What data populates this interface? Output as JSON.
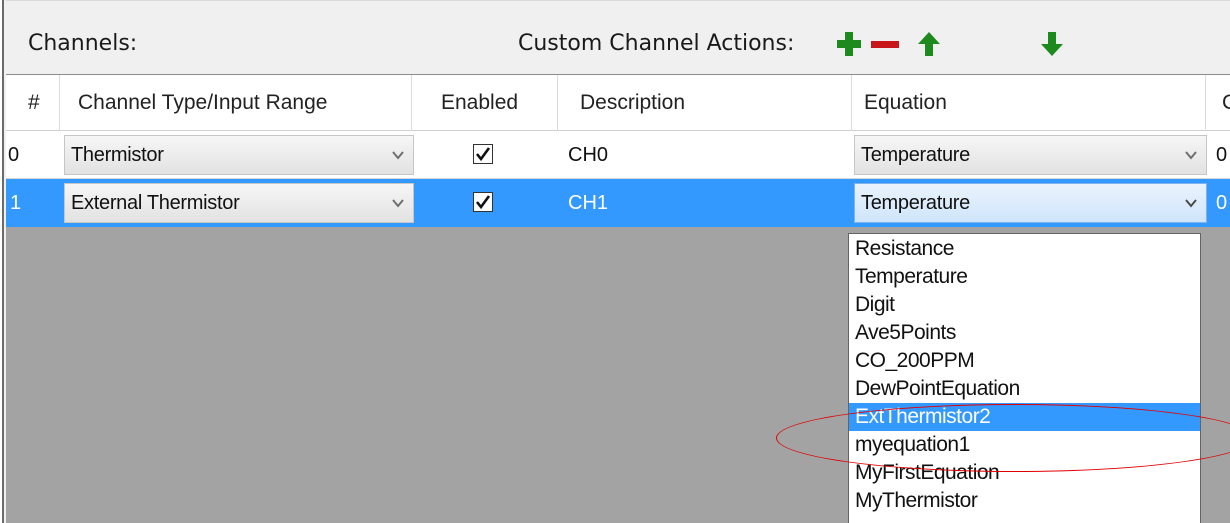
{
  "toolbar": {
    "channels_label": "Channels:",
    "actions_label": "Custom Channel Actions:",
    "add_color": "#1e8a1e",
    "remove_color": "#c8171b",
    "up_color": "#1e8a1e",
    "down_color": "#1e8a1e"
  },
  "columns": [
    "#",
    "Channel Type/Input Range",
    "Enabled",
    "Description",
    "Equation",
    "C"
  ],
  "rows": [
    {
      "index": "0",
      "type": "Thermistor",
      "enabled": true,
      "description": "CH0",
      "equation": "Temperature",
      "extra": "0"
    },
    {
      "index": "1",
      "type": "External Thermistor",
      "enabled": true,
      "description": "CH1",
      "equation": "Temperature",
      "extra": "0"
    }
  ],
  "equation_options": [
    "Resistance",
    "Temperature",
    "Digit",
    "Ave5Points",
    "CO_200PPM",
    "DewPointEquation",
    "ExtThermistor2",
    "myequation1",
    "MyFirstEquation",
    "MyThermistor"
  ],
  "highlighted_option": "ExtThermistor2",
  "colors": {
    "selection": "#3399ff",
    "grid_background": "#a3a3a3",
    "annotation": "#e10000"
  }
}
